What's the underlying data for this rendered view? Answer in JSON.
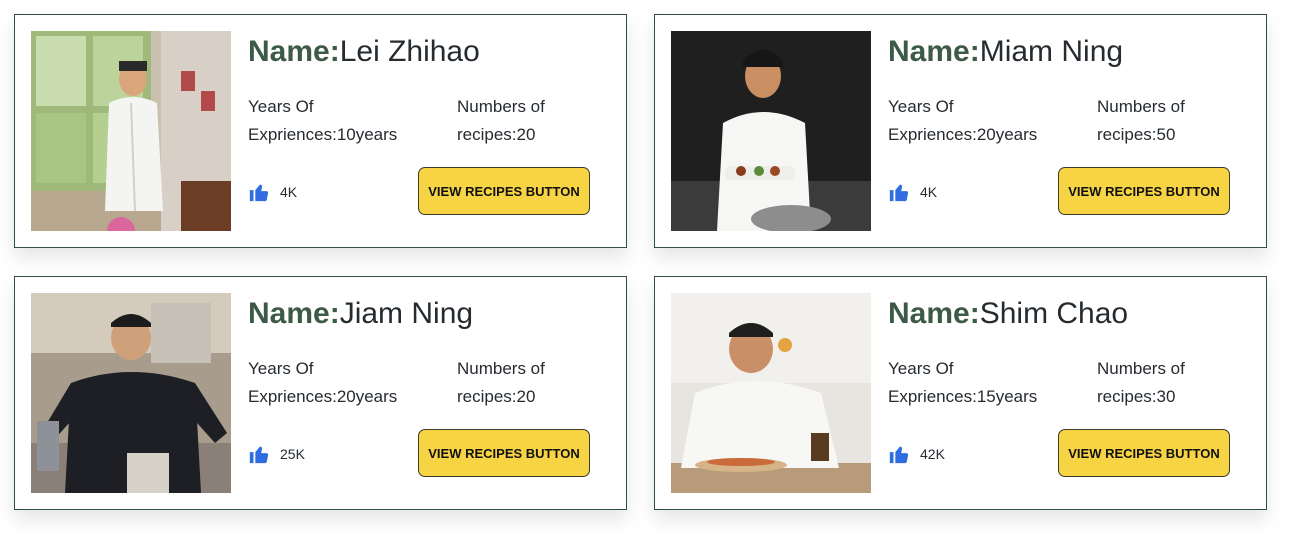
{
  "chefs": [
    {
      "name_label": "Name:",
      "name": "Lei Zhihao",
      "exp_label": "Years Of",
      "exp_value": "Expriences:10years",
      "rec_label": "Numbers of",
      "rec_value": "recipes:20",
      "likes": "4K",
      "button": "VIEW RECIPES BUTTON",
      "photo": "chef-kitchen-window"
    },
    {
      "name_label": "Name:",
      "name": "Miam Ning",
      "exp_label": "Years Of",
      "exp_value": "Expriences:20years",
      "rec_label": "Numbers of",
      "rec_value": "recipes:50",
      "likes": "4K",
      "button": "VIEW RECIPES BUTTON",
      "photo": "chef-holding-plate"
    },
    {
      "name_label": "Name:",
      "name": "Jiam Ning",
      "exp_label": "Years Of",
      "exp_value": "Expriences:20years",
      "rec_label": "Numbers of",
      "rec_value": "recipes:20",
      "likes": "25K",
      "button": "VIEW RECIPES BUTTON",
      "photo": "chef-black-uniform-cleaver"
    },
    {
      "name_label": "Name:",
      "name": "Shim Chao",
      "exp_label": "Years Of",
      "exp_value": "Expriences:15years",
      "rec_label": "Numbers of",
      "rec_value": "recipes:30",
      "likes": "42K",
      "button": "VIEW RECIPES BUTTON",
      "photo": "chef-plating-fish"
    }
  ],
  "colors": {
    "accent_label": "#3d5a47",
    "button_bg": "#f7d443",
    "thumb_icon": "#2f6de0",
    "card_border": "#2f4f3f"
  },
  "icons": {
    "likes": "thumbs-up-icon"
  }
}
